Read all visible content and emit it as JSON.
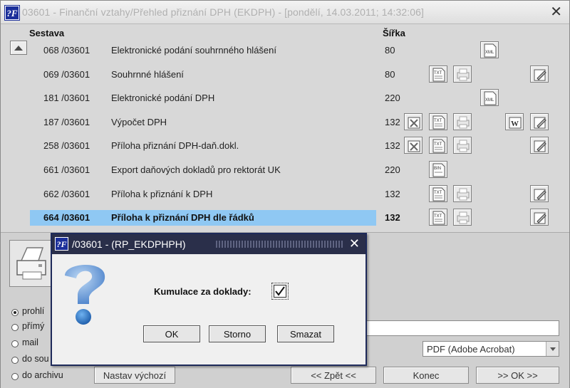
{
  "window": {
    "logo": "?F",
    "title": "03601 - Finanční vztahy/Přehled přiznání DPH (EKDPH) - [pondělí, 14.03.2011; 14:32:06]",
    "close": "✕"
  },
  "table": {
    "headers": {
      "sestava": "Sestava",
      "sirka": "Šířka"
    },
    "rows": [
      {
        "code": "068 /03601",
        "name": "Elektronické podání souhrnného hlášení",
        "width": "80",
        "icons": [
          "xml-icon"
        ]
      },
      {
        "code": "069 /03601",
        "name": "Souhrnné hlášení",
        "width": "80",
        "icons": [
          "txt-icon",
          "print-icon",
          "edit-icon"
        ]
      },
      {
        "code": "181 /03601",
        "name": "Elektronické podání DPH",
        "width": "220",
        "icons": [
          "xml-icon"
        ]
      },
      {
        "code": "187 /03601",
        "name": "Výpočet DPH",
        "width": "132",
        "icons": [
          "excel-icon",
          "txt-icon",
          "print-icon",
          "word-icon",
          "edit-icon"
        ]
      },
      {
        "code": "258 /03601",
        "name": "Příloha přiznání DPH-daň.dokl.",
        "width": "132",
        "icons": [
          "excel-icon",
          "txt-icon",
          "print-icon",
          "edit-icon"
        ]
      },
      {
        "code": "661 /03601",
        "name": "Export daňových dokladů pro rektorát UK",
        "width": "220",
        "icons": [
          "bin-icon"
        ]
      },
      {
        "code": "662 /03601",
        "name": "Příloha k přiznání k DPH",
        "width": "132",
        "icons": [
          "txt-icon",
          "print-icon",
          "edit-icon"
        ]
      },
      {
        "code": "664 /03601",
        "name": "Příloha k přiznání DPH dle řádků",
        "width": "132",
        "icons": [
          "txt-icon",
          "print-icon",
          "edit-icon"
        ],
        "selected": true
      }
    ]
  },
  "output": {
    "options": [
      {
        "label": "prohlí",
        "checked": true
      },
      {
        "label": "přímý",
        "checked": false
      },
      {
        "label": "mail",
        "checked": false
      },
      {
        "label": "do sou",
        "checked": false
      },
      {
        "label": "do archivu",
        "checked": false
      }
    ],
    "format_value": "PDF (Adobe Acrobat)",
    "buttons": {
      "default": "Nastav výchozí",
      "back": "<< Zpět <<",
      "end": "Konec",
      "ok": ">> OK >>"
    }
  },
  "dialog": {
    "logo": "?F",
    "title": "/03601 - (RP_EKDPHPH)",
    "close": "✕",
    "checkbox_label": "Kumulace za doklady:",
    "checkbox_checked": true,
    "buttons": {
      "ok": "OK",
      "cancel": "Storno",
      "delete": "Smazat"
    }
  },
  "colors": {
    "selection": "#8fc8f3",
    "dialog_title": "#2a2f4a",
    "logo": "#1b2f9a"
  }
}
